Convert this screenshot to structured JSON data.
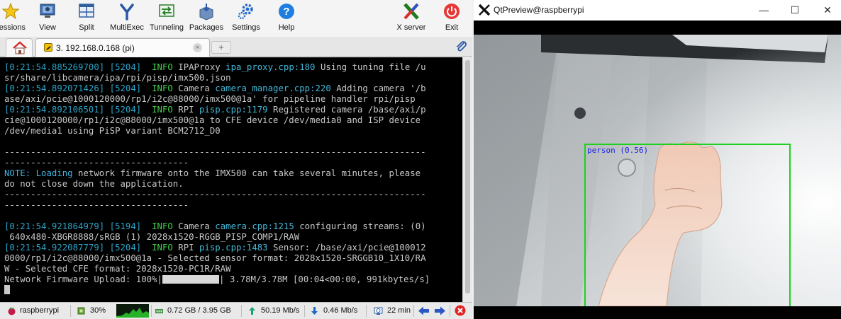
{
  "moba": {
    "toolbar": [
      {
        "key": "sessions",
        "label": "essions",
        "icon": "star-icon"
      },
      {
        "key": "view",
        "label": "View",
        "icon": "monitor-icon"
      },
      {
        "key": "split",
        "label": "Split",
        "icon": "split-window-icon"
      },
      {
        "key": "multiexec",
        "label": "MultiExec",
        "icon": "fork-icon"
      },
      {
        "key": "tunneling",
        "label": "Tunneling",
        "icon": "tunnel-icon"
      },
      {
        "key": "packages",
        "label": "Packages",
        "icon": "package-icon"
      },
      {
        "key": "settings",
        "label": "Settings",
        "icon": "gear-icon"
      },
      {
        "key": "help",
        "label": "Help",
        "icon": "help-icon"
      },
      {
        "key": "xserver",
        "label": "X server",
        "icon": "x-server-icon"
      },
      {
        "key": "exit",
        "label": "Exit",
        "icon": "power-icon"
      }
    ],
    "tab": {
      "label": "3. 192.168.0.168 (pi)",
      "close": "×",
      "new": "+"
    },
    "terminal": {
      "lines": [
        [
          {
            "t": "[0:21:54.885269700] [5204]  ",
            "c": "ts"
          },
          {
            "t": "INFO ",
            "c": "info"
          },
          {
            "t": "IPAProxy ",
            "c": ""
          },
          {
            "t": "ipa_proxy.cpp:180 ",
            "c": "src"
          },
          {
            "t": "Using tuning file /u",
            "c": ""
          }
        ],
        [
          {
            "t": "sr/share/libcamera/ipa/rpi/pisp/imx500.json",
            "c": ""
          }
        ],
        [
          {
            "t": "[0:21:54.892071426] [5204]  ",
            "c": "ts"
          },
          {
            "t": "INFO ",
            "c": "info"
          },
          {
            "t": "Camera ",
            "c": ""
          },
          {
            "t": "camera_manager.cpp:220 ",
            "c": "src"
          },
          {
            "t": "Adding camera '/b",
            "c": ""
          }
        ],
        [
          {
            "t": "ase/axi/pcie@1000120000/rp1/i2c@88000/imx500@1a' for pipeline handler rpi/pisp",
            "c": ""
          }
        ],
        [
          {
            "t": "[0:21:54.892106501] [5204]  ",
            "c": "ts"
          },
          {
            "t": "INFO ",
            "c": "info"
          },
          {
            "t": "RPI ",
            "c": ""
          },
          {
            "t": "pisp.cpp:1179 ",
            "c": "src"
          },
          {
            "t": "Registered camera /base/axi/p",
            "c": ""
          }
        ],
        [
          {
            "t": "cie@1000120000/rp1/i2c@88000/imx500@1a to CFE device /dev/media0 and ISP device",
            "c": ""
          }
        ],
        [
          {
            "t": "/dev/media1 using PiSP variant BCM2712_D0",
            "c": ""
          }
        ],
        [
          {
            "t": "",
            "c": ""
          }
        ],
        [
          {
            "t": "--------------------------------------------------------------------------------",
            "c": "dash"
          }
        ],
        [
          {
            "t": "-----------------------------------",
            "c": "dash"
          }
        ],
        [
          {
            "t": "NOTE: ",
            "c": "note"
          },
          {
            "t": "Loading ",
            "c": "note"
          },
          {
            "t": "network firmware onto the IMX500 can take several minutes, please",
            "c": ""
          }
        ],
        [
          {
            "t": "do not close down the application.",
            "c": ""
          }
        ],
        [
          {
            "t": "--------------------------------------------------------------------------------",
            "c": "dash"
          }
        ],
        [
          {
            "t": "-----------------------------------",
            "c": "dash"
          }
        ],
        [
          {
            "t": "",
            "c": ""
          }
        ],
        [
          {
            "t": "[0:21:54.921864979] [5194]  ",
            "c": "ts"
          },
          {
            "t": "INFO ",
            "c": "info"
          },
          {
            "t": "Camera ",
            "c": ""
          },
          {
            "t": "camera.cpp:1215 ",
            "c": "src"
          },
          {
            "t": "configuring streams: (0)",
            "c": ""
          }
        ],
        [
          {
            "t": " 640x480-XBGR8888/sRGB (1) 2028x1520-RGGB_PISP_COMP1/RAW",
            "c": ""
          }
        ],
        [
          {
            "t": "[0:21:54.922087779] [5204]  ",
            "c": "ts"
          },
          {
            "t": "INFO ",
            "c": "info"
          },
          {
            "t": "RPI ",
            "c": ""
          },
          {
            "t": "pisp.cpp:1483 ",
            "c": "src"
          },
          {
            "t": "Sensor: /base/axi/pcie@100012",
            "c": ""
          }
        ],
        [
          {
            "t": "0000/rp1/i2c@88000/imx500@1a - Selected sensor format: 2028x1520-SRGGB10_1X10/RA",
            "c": ""
          }
        ],
        [
          {
            "t": "W - Selected CFE format: 2028x1520-PC1R/RAW",
            "c": ""
          }
        ]
      ],
      "progress_prefix": "Network Firmware Upload: 100%|",
      "progress_percent": 100,
      "progress_suffix": "| 3.78M/3.78M [00:04<00:00, 991kbytes/s]"
    },
    "status": {
      "host": "raspberrypi",
      "cpu": "30%",
      "memory": "0.72 GB / 3.95 GB",
      "upload": "50.19 Mb/s",
      "download": "0.46 Mb/s",
      "uptime": "22 min"
    }
  },
  "qt": {
    "title": "QtPreview@raspberrypi",
    "minimize": "—",
    "maximize": "☐",
    "close": "✕",
    "detection_label": "person (0.56)",
    "colors": {
      "box": "#1fd11f",
      "label": "#1a24e6"
    }
  }
}
